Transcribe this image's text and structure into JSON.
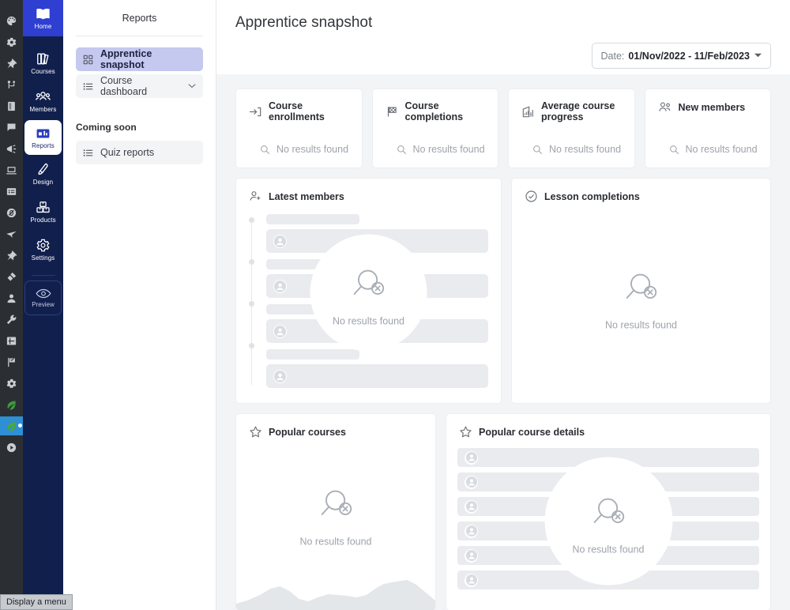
{
  "os_rail": {
    "items": [
      {
        "name": "palette-icon",
        "glyph": "palette"
      },
      {
        "name": "gear-icon",
        "glyph": "gear"
      },
      {
        "name": "pin-icon",
        "glyph": "pin"
      },
      {
        "name": "branch-icon",
        "glyph": "branch"
      },
      {
        "name": "book-icon",
        "glyph": "book"
      },
      {
        "name": "chat-icon",
        "glyph": "chat"
      },
      {
        "name": "megaphone-icon",
        "glyph": "megaphone"
      },
      {
        "name": "laptop-icon",
        "glyph": "laptop"
      },
      {
        "name": "form-icon",
        "glyph": "form"
      },
      {
        "name": "zero-block-icon",
        "glyph": "zeroblock"
      },
      {
        "name": "paper-plane-icon",
        "glyph": "plane"
      },
      {
        "name": "pushpin-icon",
        "glyph": "pushpin"
      },
      {
        "name": "plug-icon",
        "glyph": "plug"
      },
      {
        "name": "person-icon",
        "glyph": "person"
      },
      {
        "name": "wrench-icon",
        "glyph": "wrench"
      },
      {
        "name": "layout-icon",
        "glyph": "layout"
      },
      {
        "name": "flag-check-icon",
        "glyph": "flagcheck"
      },
      {
        "name": "settings-icon",
        "glyph": "gear"
      },
      {
        "name": "leaf-icon",
        "glyph": "leaf"
      },
      {
        "name": "leaf-selected-icon",
        "glyph": "leaf",
        "selected": true,
        "badge": true
      },
      {
        "name": "play-icon",
        "glyph": "play"
      }
    ]
  },
  "nav": {
    "items": [
      {
        "label": "Home",
        "icon": "book-leaf-icon",
        "state": "home"
      },
      {
        "label": "Courses",
        "icon": "books-icon",
        "state": "normal"
      },
      {
        "label": "Members",
        "icon": "people-icon",
        "state": "normal"
      },
      {
        "label": "Reports",
        "icon": "reports-icon",
        "state": "active"
      },
      {
        "label": "Design",
        "icon": "brush-icon",
        "state": "normal"
      },
      {
        "label": "Products",
        "icon": "boxes-icon",
        "state": "normal"
      },
      {
        "label": "Settings",
        "icon": "gear-icon",
        "state": "normal"
      }
    ],
    "preview": {
      "label": "Preview",
      "icon": "eye-icon"
    }
  },
  "sub_panel": {
    "title": "Reports",
    "items": [
      {
        "label": "Apprentice snapshot",
        "icon": "grid-icon",
        "selected": true,
        "chevron": false
      },
      {
        "label": "Course dashboard",
        "icon": "list-icon",
        "selected": false,
        "chevron": true
      }
    ],
    "group_label": "Coming soon",
    "group_items": [
      {
        "label": "Quiz reports",
        "icon": "list-icon",
        "selected": false,
        "chevron": false
      }
    ]
  },
  "header": {
    "title": "Apprentice snapshot",
    "date_picker": {
      "label": "Date:",
      "value": "01/Nov/2022 - 11/Feb/2023",
      "caret": "▾"
    }
  },
  "empty_text": "No results found",
  "stats": [
    {
      "title": "Course enrollments",
      "icon": "enter-arrow-icon",
      "empty": "No results found"
    },
    {
      "title": "Course completions",
      "icon": "checkered-flag-icon",
      "empty": "No results found"
    },
    {
      "title": "Average course progress",
      "icon": "bar-chart-up-icon",
      "empty": "No results found"
    },
    {
      "title": "New members",
      "icon": "people-icon",
      "empty": "No results found"
    }
  ],
  "panels": {
    "latest_members": {
      "title": "Latest members",
      "icon": "person-plus-icon",
      "empty": "No results found"
    },
    "lesson_completions": {
      "title": "Lesson completions",
      "icon": "check-circle-icon",
      "empty": "No results found"
    },
    "popular_courses": {
      "title": "Popular courses",
      "icon": "star-icon",
      "empty": "No results found"
    },
    "popular_course_details": {
      "title": "Popular course details",
      "icon": "star-icon",
      "empty": "No results found"
    }
  },
  "tooltip": {
    "text": "Display a menu"
  },
  "colors": {
    "nav_bg": "#111f4d",
    "home_bg": "#2f3fd1",
    "selected_item": "#c5c9ef",
    "board_bg": "#f3f4f6",
    "skeleton": "#e9ebee",
    "muted_text": "#9ea3ab"
  }
}
